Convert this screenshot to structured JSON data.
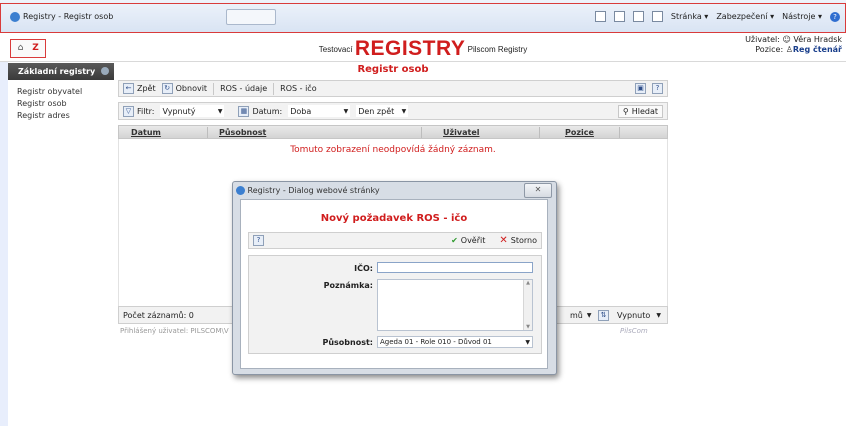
{
  "browser": {
    "tab_title": "Registry - Registr osob",
    "menu": [
      "Stránka ▾",
      "Zabezpečení ▾",
      "Nástroje ▾"
    ]
  },
  "header": {
    "brand_pre": "Testovací",
    "brand_main": "REGISTRY",
    "brand_post": "Pilscom Registry",
    "user_label": "Uživatel:",
    "user_name": "Věra Hradsk",
    "role_label": "Pozice:",
    "role_name": "Reg čtenář"
  },
  "sidebar": {
    "title": "Základní registry",
    "items": [
      {
        "label": "Registr obyvatel"
      },
      {
        "label": "Registr osob"
      },
      {
        "label": "Registr adres"
      }
    ]
  },
  "main": {
    "title": "Registr osob",
    "toolbar": {
      "back": "Zpět",
      "refresh": "Obnovit",
      "ros_udaje": "ROS - údaje",
      "ros_ico": "ROS - ičo"
    },
    "filter": {
      "filter_label": "Filtr:",
      "filter_value": "Vypnutý",
      "date_label": "Datum:",
      "date_value": "Doba",
      "period_value": "Den zpět",
      "search": "Hledat"
    },
    "columns": [
      "Datum",
      "Působnost",
      "Uživatel",
      "Pozice"
    ],
    "empty_message": "Tomuto zobrazení neodpovídá žádný záznam.",
    "footer": {
      "count_label": "Počet záznamů: 0",
      "page_size_suffix": "mů",
      "off_value": "Vypnuto"
    },
    "login_info": "Přihlášený uživatel: PILSCOM\\V",
    "brand_small": "PilsCom"
  },
  "dialog": {
    "window_title": "Registry - Dialog webové stránky",
    "heading": "Nový požadavek ROS - ičo",
    "verify": "Ověřit",
    "cancel": "Storno",
    "ico_label": "IČO:",
    "ico_value": "",
    "note_label": "Poznámka:",
    "note_value": "",
    "scope_label": "Působnost:",
    "scope_value": "Ageda 01 - Role 010 - Důvod 01"
  },
  "colors": {
    "accent_red": "#d01d1d",
    "user_blue": "#1a3f8c",
    "verify_green": "#2e9a2e"
  }
}
